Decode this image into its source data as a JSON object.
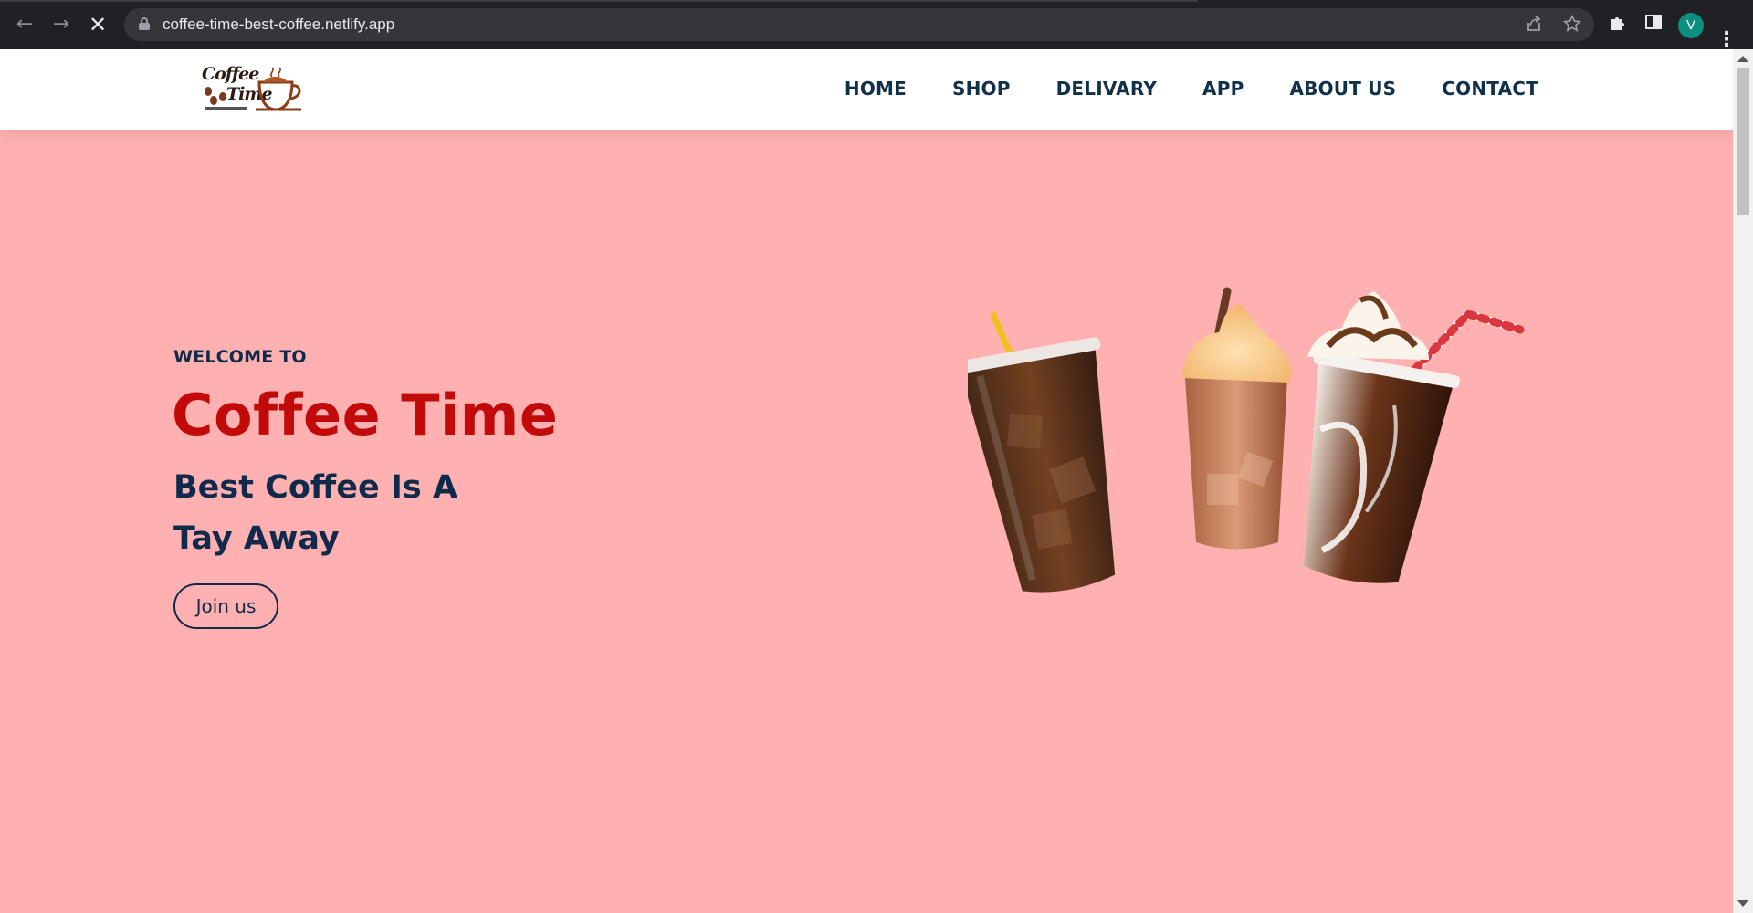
{
  "browser": {
    "url": "coffee-time-best-coffee.netlify.app",
    "avatar_letter": "V",
    "icons": [
      "back-arrow-icon",
      "forward-arrow-icon",
      "stop-loading-icon",
      "lock-icon",
      "share-icon",
      "star-icon",
      "extensions-icon",
      "side-panel-icon",
      "kebab-menu-icon"
    ]
  },
  "header": {
    "logo_text_line1": "Coffee",
    "logo_text_line2": "Time",
    "nav": [
      "HOME",
      "SHOP",
      "DELIVARY",
      "APP",
      "ABOUT US",
      "CONTACT"
    ]
  },
  "hero": {
    "welcome": "WELCOME TO",
    "title": "Coffee Time",
    "subtitle_line1": "Best Coffee Is A",
    "subtitle_line2": "Tay Away",
    "button": "Join us"
  },
  "colors": {
    "hero_bg": "#ffb0b1",
    "title_red": "#c20a0a",
    "navy": "#0f2a4a"
  }
}
